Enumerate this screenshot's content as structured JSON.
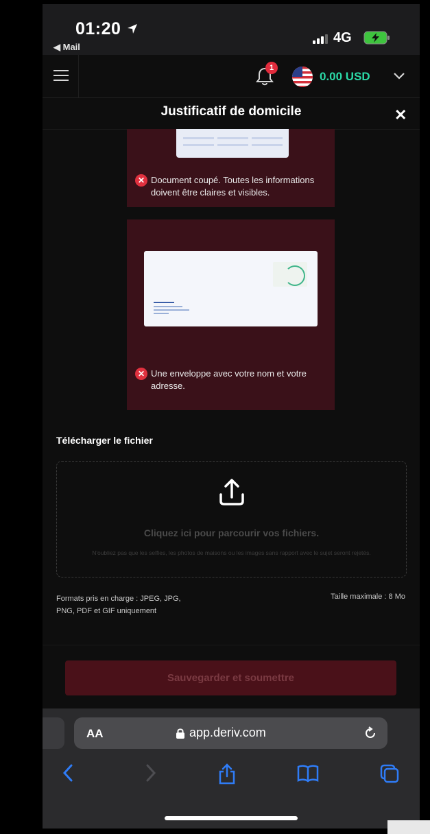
{
  "status_bar": {
    "time": "01:20",
    "back_label": "◀ Mail",
    "network": "4G"
  },
  "header": {
    "notification_count": "1",
    "balance": "0.00 USD"
  },
  "dialog": {
    "title": "Justificatif de domicile"
  },
  "examples": [
    {
      "error_text": "Document coupé. Toutes les informations doivent être claires et visibles."
    },
    {
      "error_text": "Une enveloppe avec votre nom et votre adresse."
    }
  ],
  "upload": {
    "section_label": "Télécharger le fichier",
    "drop_main": "Cliquez ici pour parcourir vos fichiers.",
    "drop_note": "N'oubliez pas que les selfies, les photos de maisons ou les images sans rapport avec le sujet seront rejetés.",
    "formats": "Formats pris en charge : JPEG, JPG, PNG, PDF et GIF uniquement",
    "max_size": "Taille maximale : 8 Mo"
  },
  "submit_label": "Sauvegarder et soumettre",
  "browser": {
    "aa_label": "AA",
    "url": "app.deriv.com"
  },
  "colors": {
    "accent": "#2bd9a7",
    "error": "#e0313f",
    "card_bg": "#3a1119",
    "submit_bg": "#4a1119"
  }
}
